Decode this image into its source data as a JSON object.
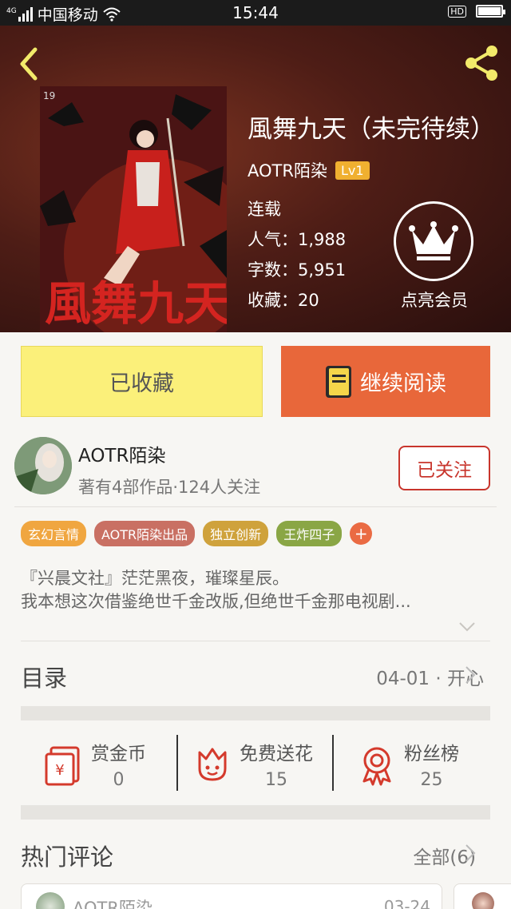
{
  "status_bar": {
    "network": "4G",
    "carrier": "中国移动",
    "time": "15:44",
    "call_icon": "HD"
  },
  "header": {
    "book_title": "風舞九天（未完待续）",
    "author": "AOTR陌染",
    "level_badge": "Lv1",
    "status": "连载",
    "popularity_label": "人气：",
    "popularity": "1,988",
    "word_count_label": "字数：",
    "word_count": "5,951",
    "favorites_label": "收藏：",
    "favorites": "20",
    "vip_label": "点亮会员"
  },
  "actions": {
    "favorite_label": "已收藏",
    "read_label": "继续阅读"
  },
  "author_card": {
    "name": "AOTR陌染",
    "stats": "著有4部作品·124人关注",
    "follow_label": "已关注"
  },
  "tags": [
    {
      "label": "玄幻言情",
      "color": "#f0a640"
    },
    {
      "label": "AOTR陌染出品",
      "color": "#c97063"
    },
    {
      "label": "独立创新",
      "color": "#cfa23c"
    },
    {
      "label": "王炸四子",
      "color": "#8aa645"
    }
  ],
  "description": {
    "line1": "『兴晨文社』茫茫黑夜，璀璨星辰。",
    "line2": "我本想这次借鉴绝世千金改版,但绝世千金那电视剧..."
  },
  "toc": {
    "title": "目录",
    "latest": "04-01 · 开心"
  },
  "stats": [
    {
      "label": "赏金币",
      "value": "0",
      "icon": "red-envelope-icon"
    },
    {
      "label": "免费送花",
      "value": "15",
      "icon": "flower-icon"
    },
    {
      "label": "粉丝榜",
      "value": "25",
      "icon": "medal-icon"
    }
  ],
  "comments": {
    "title": "热门评论",
    "all_label": "全部(6)",
    "items": [
      {
        "author": "AOTR陌染",
        "date": "03-24"
      }
    ]
  },
  "colors": {
    "accent_orange": "#e8673a",
    "fav_yellow": "#fbf07a",
    "follow_red": "#c8352c",
    "icon_red": "#d43a2c"
  }
}
